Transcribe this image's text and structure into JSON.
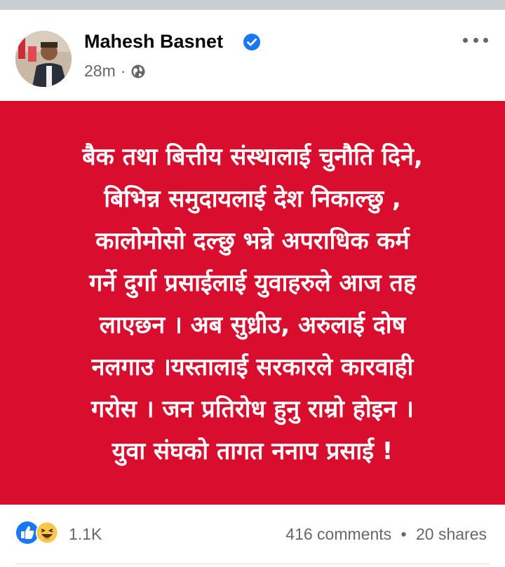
{
  "post": {
    "author_name": "Mahesh Basnet",
    "time": "28m",
    "meta_separator": "·",
    "audience_icon": "globe-icon",
    "verified_icon": "verified-badge-icon",
    "more_icon": "more-options-icon",
    "card_color": "#d90d2e",
    "text_lines": [
      "बैक तथा बित्तीय संस्थालाई चुनौति दिने,",
      "बिभिन्न समुदायलाई देश निकाल्छु ,",
      "कालोमोसो दल्छु भन्ने अपराधिक कर्म",
      "गर्ने दुर्गा प्रसाईलाई  युवाहरुले आज तह",
      "लाएछन । अब सुध्रीउ, अरुलाई दोष",
      "नलगाउ ।यस्तालाई सरकारले कारवाही",
      "गरोस । जन प्रतिरोध हुनु राम्रो होइन ।",
      "युवा संघको तागत ननाप प्रसाई !"
    ]
  },
  "footer": {
    "reactions_icons": [
      "like-icon",
      "haha-icon"
    ],
    "reaction_count": "1.1K",
    "comments": "416 comments",
    "separator": "•",
    "shares": "20 shares"
  }
}
